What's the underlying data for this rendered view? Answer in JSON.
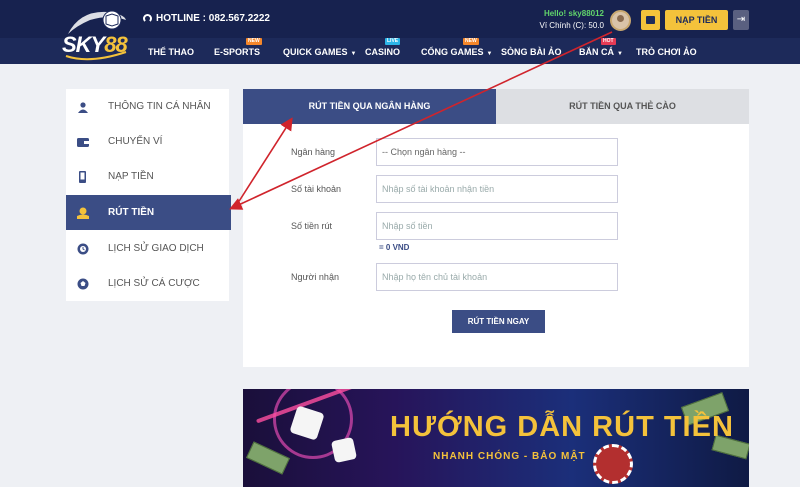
{
  "header": {
    "logo": "SKY88",
    "hotline": "HOTLINE : 082.567.2222",
    "user_greeting": "Hello! sky88012",
    "user_wallet": "Ví Chính (C): 50.0",
    "deposit_label": "NẠP TIỀN",
    "nav": [
      {
        "label": "THỂ THAO",
        "badge": "",
        "caret": false
      },
      {
        "label": "E-SPORTS",
        "badge": "NEW",
        "caret": false
      },
      {
        "label": "QUICK GAMES",
        "badge": "",
        "caret": true
      },
      {
        "label": "CASINO",
        "badge": "LIVE",
        "caret": false
      },
      {
        "label": "CỔNG GAMES",
        "badge": "NEW",
        "caret": true
      },
      {
        "label": "SÒNG BÀI ẢO",
        "badge": "",
        "caret": false
      },
      {
        "label": "BẮN CÁ",
        "badge": "HOT",
        "caret": true
      },
      {
        "label": "TRÒ CHƠI ẢO",
        "badge": "",
        "caret": false
      }
    ]
  },
  "sidebar": {
    "items": [
      {
        "label": "THÔNG TIN CÁ NHÂN",
        "icon": "user-icon",
        "active": false
      },
      {
        "label": "CHUYỂN VÍ",
        "icon": "wallet-icon",
        "active": false
      },
      {
        "label": "NẠP TIỀN",
        "icon": "phone-icon",
        "active": false
      },
      {
        "label": "RÚT TIỀN",
        "icon": "withdraw-icon",
        "active": true
      },
      {
        "label": "LỊCH SỬ GIAO DỊCH",
        "icon": "history-icon",
        "active": false
      },
      {
        "label": "LỊCH SỬ CÁ CƯỢC",
        "icon": "ball-icon",
        "active": false
      }
    ]
  },
  "panel": {
    "tabs": [
      {
        "label": "RÚT TIỀN QUA NGÂN HÀNG",
        "active": true
      },
      {
        "label": "RÚT TIỀN QUA THẺ CÀO",
        "active": false
      }
    ],
    "form": {
      "bank_label": "Ngân hàng",
      "bank_select": "-- Chọn ngân hàng --",
      "account_label": "Số tài khoản",
      "account_placeholder": "Nhập số tài khoản nhận tiền",
      "amount_label": "Số tiền rút",
      "amount_placeholder": "Nhập số tiền",
      "amount_hint": "= 0 VND",
      "receiver_label": "Người nhận",
      "receiver_placeholder": "Nhập họ tên chủ tài khoản",
      "submit_label": "RÚT TIỀN NGAY"
    }
  },
  "banner": {
    "title": "HƯỚNG DẪN RÚT TIỀN",
    "subtitle": "NHANH CHÓNG - BẢO MẬT"
  },
  "colors": {
    "header_bg": "#1d2a5a",
    "accent_yellow": "#f4c23b",
    "active_blue": "#3b4d85",
    "annotation_red": "#d0242c"
  }
}
